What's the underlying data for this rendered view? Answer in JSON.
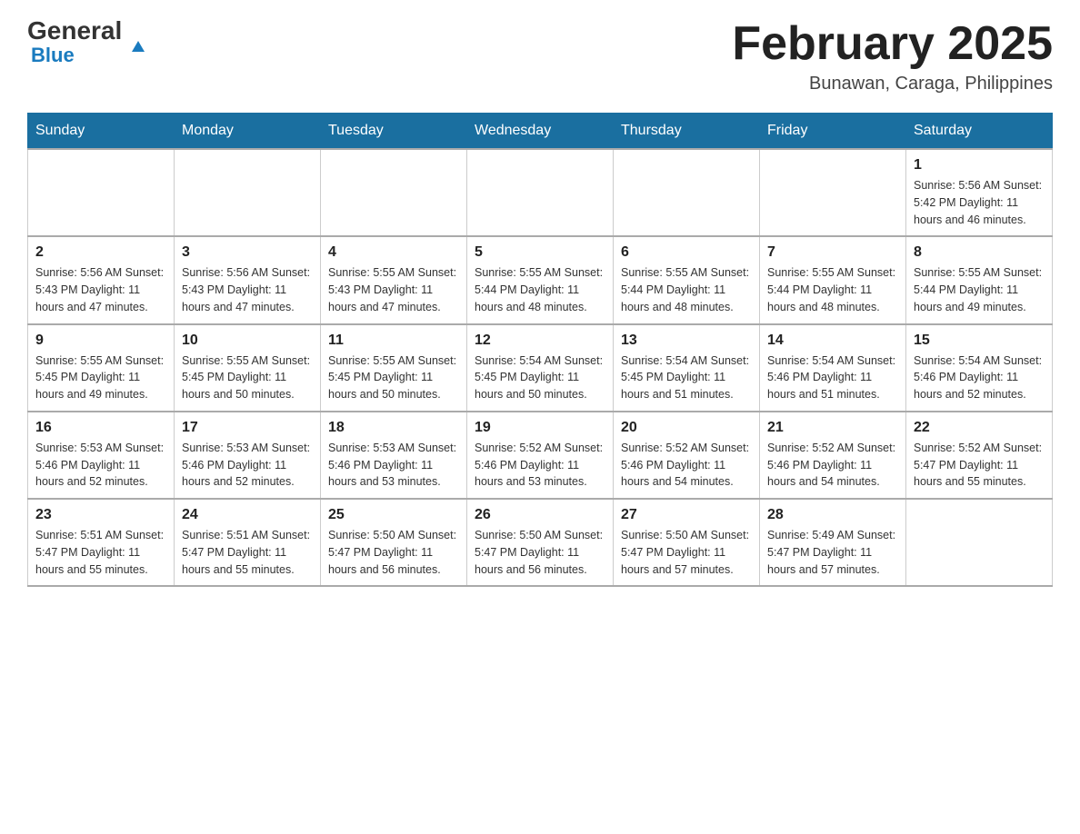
{
  "header": {
    "logo_general": "General",
    "logo_blue": "Blue",
    "month_title": "February 2025",
    "location": "Bunawan, Caraga, Philippines"
  },
  "weekdays": [
    "Sunday",
    "Monday",
    "Tuesday",
    "Wednesday",
    "Thursday",
    "Friday",
    "Saturday"
  ],
  "weeks": [
    [
      {
        "day": "",
        "info": ""
      },
      {
        "day": "",
        "info": ""
      },
      {
        "day": "",
        "info": ""
      },
      {
        "day": "",
        "info": ""
      },
      {
        "day": "",
        "info": ""
      },
      {
        "day": "",
        "info": ""
      },
      {
        "day": "1",
        "info": "Sunrise: 5:56 AM\nSunset: 5:42 PM\nDaylight: 11 hours and 46 minutes."
      }
    ],
    [
      {
        "day": "2",
        "info": "Sunrise: 5:56 AM\nSunset: 5:43 PM\nDaylight: 11 hours and 47 minutes."
      },
      {
        "day": "3",
        "info": "Sunrise: 5:56 AM\nSunset: 5:43 PM\nDaylight: 11 hours and 47 minutes."
      },
      {
        "day": "4",
        "info": "Sunrise: 5:55 AM\nSunset: 5:43 PM\nDaylight: 11 hours and 47 minutes."
      },
      {
        "day": "5",
        "info": "Sunrise: 5:55 AM\nSunset: 5:44 PM\nDaylight: 11 hours and 48 minutes."
      },
      {
        "day": "6",
        "info": "Sunrise: 5:55 AM\nSunset: 5:44 PM\nDaylight: 11 hours and 48 minutes."
      },
      {
        "day": "7",
        "info": "Sunrise: 5:55 AM\nSunset: 5:44 PM\nDaylight: 11 hours and 48 minutes."
      },
      {
        "day": "8",
        "info": "Sunrise: 5:55 AM\nSunset: 5:44 PM\nDaylight: 11 hours and 49 minutes."
      }
    ],
    [
      {
        "day": "9",
        "info": "Sunrise: 5:55 AM\nSunset: 5:45 PM\nDaylight: 11 hours and 49 minutes."
      },
      {
        "day": "10",
        "info": "Sunrise: 5:55 AM\nSunset: 5:45 PM\nDaylight: 11 hours and 50 minutes."
      },
      {
        "day": "11",
        "info": "Sunrise: 5:55 AM\nSunset: 5:45 PM\nDaylight: 11 hours and 50 minutes."
      },
      {
        "day": "12",
        "info": "Sunrise: 5:54 AM\nSunset: 5:45 PM\nDaylight: 11 hours and 50 minutes."
      },
      {
        "day": "13",
        "info": "Sunrise: 5:54 AM\nSunset: 5:45 PM\nDaylight: 11 hours and 51 minutes."
      },
      {
        "day": "14",
        "info": "Sunrise: 5:54 AM\nSunset: 5:46 PM\nDaylight: 11 hours and 51 minutes."
      },
      {
        "day": "15",
        "info": "Sunrise: 5:54 AM\nSunset: 5:46 PM\nDaylight: 11 hours and 52 minutes."
      }
    ],
    [
      {
        "day": "16",
        "info": "Sunrise: 5:53 AM\nSunset: 5:46 PM\nDaylight: 11 hours and 52 minutes."
      },
      {
        "day": "17",
        "info": "Sunrise: 5:53 AM\nSunset: 5:46 PM\nDaylight: 11 hours and 52 minutes."
      },
      {
        "day": "18",
        "info": "Sunrise: 5:53 AM\nSunset: 5:46 PM\nDaylight: 11 hours and 53 minutes."
      },
      {
        "day": "19",
        "info": "Sunrise: 5:52 AM\nSunset: 5:46 PM\nDaylight: 11 hours and 53 minutes."
      },
      {
        "day": "20",
        "info": "Sunrise: 5:52 AM\nSunset: 5:46 PM\nDaylight: 11 hours and 54 minutes."
      },
      {
        "day": "21",
        "info": "Sunrise: 5:52 AM\nSunset: 5:46 PM\nDaylight: 11 hours and 54 minutes."
      },
      {
        "day": "22",
        "info": "Sunrise: 5:52 AM\nSunset: 5:47 PM\nDaylight: 11 hours and 55 minutes."
      }
    ],
    [
      {
        "day": "23",
        "info": "Sunrise: 5:51 AM\nSunset: 5:47 PM\nDaylight: 11 hours and 55 minutes."
      },
      {
        "day": "24",
        "info": "Sunrise: 5:51 AM\nSunset: 5:47 PM\nDaylight: 11 hours and 55 minutes."
      },
      {
        "day": "25",
        "info": "Sunrise: 5:50 AM\nSunset: 5:47 PM\nDaylight: 11 hours and 56 minutes."
      },
      {
        "day": "26",
        "info": "Sunrise: 5:50 AM\nSunset: 5:47 PM\nDaylight: 11 hours and 56 minutes."
      },
      {
        "day": "27",
        "info": "Sunrise: 5:50 AM\nSunset: 5:47 PM\nDaylight: 11 hours and 57 minutes."
      },
      {
        "day": "28",
        "info": "Sunrise: 5:49 AM\nSunset: 5:47 PM\nDaylight: 11 hours and 57 minutes."
      },
      {
        "day": "",
        "info": ""
      }
    ]
  ]
}
